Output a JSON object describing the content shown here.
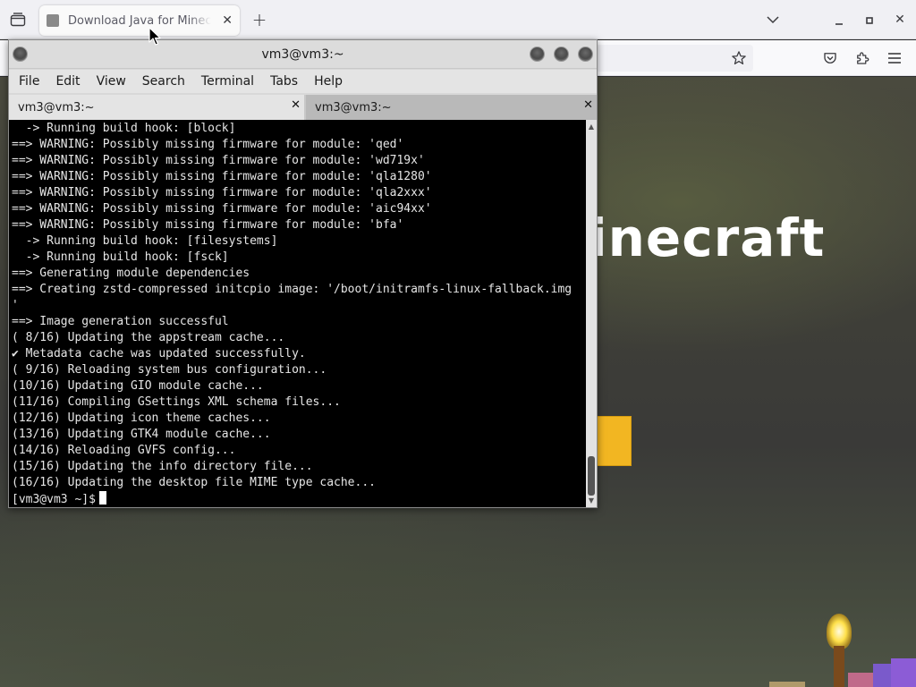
{
  "browser": {
    "tab_title": "Download Java for Minecraft",
    "tab_close": "✕",
    "new_tab": "+",
    "icons": {
      "tab_list": "tab-list-icon",
      "favicon": "minecraft-block-icon",
      "dropdown": "chevron-down-icon",
      "bookmark": "star-icon",
      "pocket": "pocket-icon",
      "extensions": "puzzle-icon",
      "menu": "hamburger-icon"
    },
    "window_controls": {
      "minimize": "–",
      "maximize": "▪",
      "close": "✕"
    }
  },
  "page": {
    "hero_title": "Minecraft",
    "accent_color": "#f2b622"
  },
  "terminal": {
    "title": "vm3@vm3:~",
    "menu": [
      "File",
      "Edit",
      "View",
      "Search",
      "Terminal",
      "Tabs",
      "Help"
    ],
    "tabs": [
      {
        "label": "vm3@vm3:~",
        "active": true
      },
      {
        "label": "vm3@vm3:~",
        "active": false
      }
    ],
    "lines": [
      "  -> Running build hook: [block]",
      "==> WARNING: Possibly missing firmware for module: 'qed'",
      "==> WARNING: Possibly missing firmware for module: 'wd719x'",
      "==> WARNING: Possibly missing firmware for module: 'qla1280'",
      "==> WARNING: Possibly missing firmware for module: 'qla2xxx'",
      "==> WARNING: Possibly missing firmware for module: 'aic94xx'",
      "==> WARNING: Possibly missing firmware for module: 'bfa'",
      "  -> Running build hook: [filesystems]",
      "  -> Running build hook: [fsck]",
      "==> Generating module dependencies",
      "==> Creating zstd-compressed initcpio image: '/boot/initramfs-linux-fallback.img",
      "'",
      "==> Image generation successful",
      "( 8/16) Updating the appstream cache...",
      "✔ Metadata cache was updated successfully.",
      "( 9/16) Reloading system bus configuration...",
      "(10/16) Updating GIO module cache...",
      "(11/16) Compiling GSettings XML schema files...",
      "(12/16) Updating icon theme caches...",
      "(13/16) Updating GTK4 module cache...",
      "(14/16) Reloading GVFS config...",
      "(15/16) Updating the info directory file...",
      "(16/16) Updating the desktop file MIME type cache..."
    ],
    "prompt": "[vm3@vm3 ~]$"
  }
}
